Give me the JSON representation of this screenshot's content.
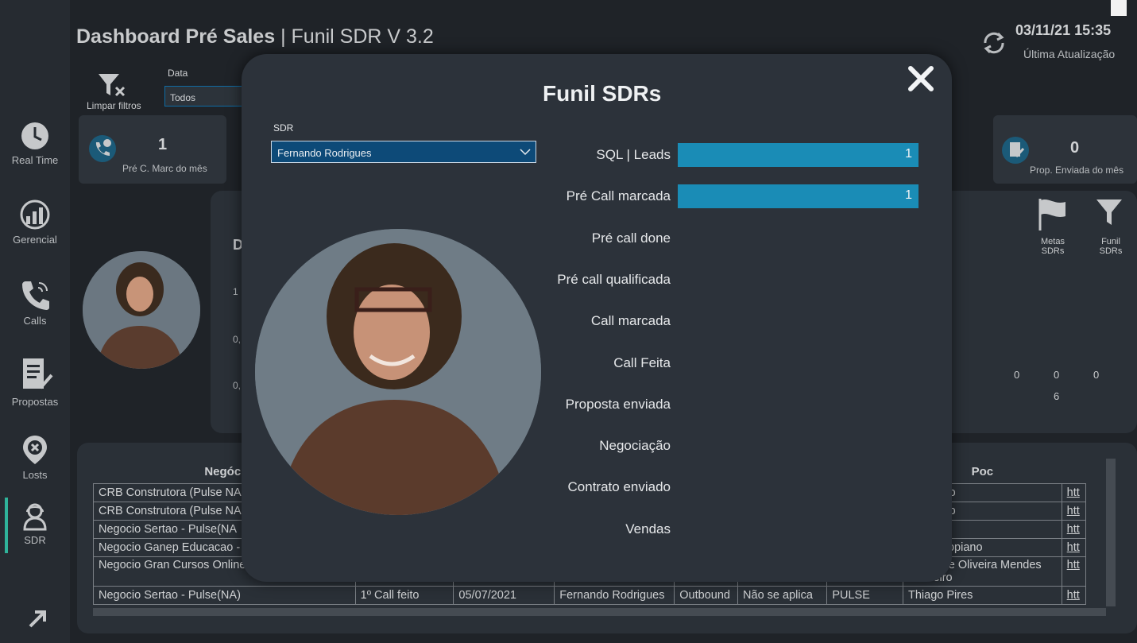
{
  "header": {
    "title_bold": "Dashboard Pré Sales",
    "title_sep": "|",
    "title_rest": "Funil SDR V 3.2",
    "update_date": "03/11/21 15:35",
    "update_label": "Última Atualização"
  },
  "filters": {
    "clear_label": "Limpar filtros",
    "date_label": "Data",
    "date_value": "Todos"
  },
  "sidebar": {
    "items": [
      {
        "label": "Real Time",
        "icon": "clock-icon"
      },
      {
        "label": "Gerencial",
        "icon": "chart-growth-icon"
      },
      {
        "label": "Calls",
        "icon": "phone-icon"
      },
      {
        "label": "Propostas",
        "icon": "document-edit-icon"
      },
      {
        "label": "Losts",
        "icon": "target-x-icon"
      },
      {
        "label": "SDR",
        "icon": "agent-icon"
      }
    ]
  },
  "cards": {
    "left": {
      "value": "1",
      "label": "Pré C. Marc do mês"
    },
    "right": {
      "value": "0",
      "label": "Prop. Enviada do mês"
    }
  },
  "side_buttons": {
    "metas": "Metas SDRs",
    "funil": "Funil SDRs"
  },
  "background_panel": {
    "letter": "D",
    "axis_1": "1",
    "axis_2": "0,",
    "axis_3": "0,",
    "n1": "0",
    "n2": "0",
    "n3": "0",
    "n4": "6"
  },
  "table": {
    "headers": {
      "negocio": "Negóci",
      "poc": "Poc"
    },
    "rows": [
      {
        "negocio": "CRB Construtora (Pulse NA",
        "poc": "Camargo",
        "link": "htt"
      },
      {
        "negocio": "CRB Construtora (Pulse NA",
        "poc": "Camargo",
        "link": "htt"
      },
      {
        "negocio": "Negocio Sertao - Pulse(NA",
        "poc": "o Pires",
        "link": "htt"
      },
      {
        "negocio": "Negocio Ganep Educacao -",
        "poc": "erme Tropiano",
        "link": "htt"
      },
      {
        "negocio": "Negocio Gran Cursos Online",
        "poc": "a Nazare Oliveira Mendes",
        "poc2": "Carneiro",
        "link": "htt"
      }
    ],
    "full_row": {
      "negocio": "Negocio Sertao - Pulse(NA)",
      "stage": "1º Call feito",
      "date": "05/07/2021",
      "sdr": "Fernando Rodrigues",
      "origin": "Outbound",
      "applies": "Não se aplica",
      "product": "PULSE",
      "poc": "Thiago Pires",
      "link": "htt"
    }
  },
  "modal": {
    "title": "Funil SDRs",
    "close_label": "✕",
    "sdr_label": "SDR",
    "sdr_value": "Fernando Rodrigues",
    "funnel": [
      {
        "label": "SQL | Leads",
        "value": 1
      },
      {
        "label": "Pré Call marcada",
        "value": 1
      },
      {
        "label": "Pré call done",
        "value": null
      },
      {
        "label": "Pré call qualificada",
        "value": null
      },
      {
        "label": "Call marcada",
        "value": null
      },
      {
        "label": "Call Feita",
        "value": null
      },
      {
        "label": "Proposta enviada",
        "value": null
      },
      {
        "label": "Negociação",
        "value": null
      },
      {
        "label": "Contrato enviado",
        "value": null
      },
      {
        "label": "Vendas",
        "value": null
      }
    ],
    "bar_color": "#1a8cb6"
  }
}
